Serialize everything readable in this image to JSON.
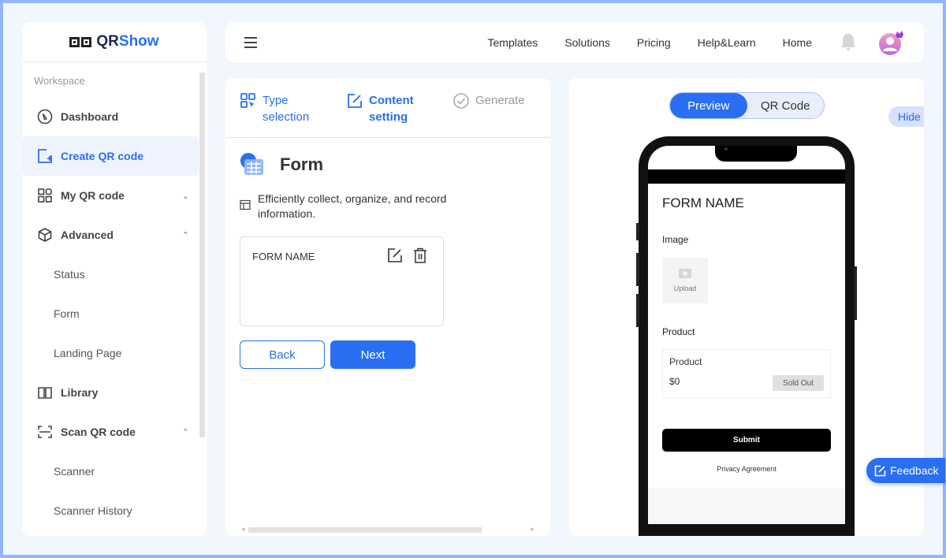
{
  "brand": {
    "name_prefix": "QR",
    "name_suffix": "Show"
  },
  "sidebar": {
    "section_label": "Workspace",
    "items": [
      {
        "label": "Dashboard",
        "icon": "dashboard-icon"
      },
      {
        "label": "Create QR code",
        "icon": "create-qr-icon",
        "active": true
      },
      {
        "label": "My QR code",
        "icon": "qr-grid-icon",
        "chevron": "down"
      },
      {
        "label": "Advanced",
        "icon": "cube-icon",
        "chevron": "up"
      },
      {
        "label": "Library",
        "icon": "book-icon"
      },
      {
        "label": "Scan QR code",
        "icon": "scan-icon",
        "chevron": "up"
      }
    ],
    "advanced_subitems": [
      "Status",
      "Form",
      "Landing Page"
    ],
    "scan_subitems": [
      "Scanner",
      "Scanner History"
    ]
  },
  "topbar": {
    "nav": [
      "Templates",
      "Solutions",
      "Pricing",
      "Help&Learn",
      "Home"
    ]
  },
  "steps": {
    "type_line1": "Type",
    "type_line2": "selection",
    "content_line1": "Content",
    "content_line2": "setting",
    "generate": "Generate"
  },
  "editor": {
    "title": "Form",
    "description": "Efficiently collect, organize, and record information.",
    "form_name": "FORM NAME",
    "back_label": "Back",
    "next_label": "Next"
  },
  "preview": {
    "tabs": [
      "Preview",
      "QR Code"
    ],
    "active_tab": "Preview",
    "hide_label": "Hide",
    "phone": {
      "form_title": "FORM NAME",
      "image_label": "Image",
      "upload_label": "Upload",
      "product_label": "Product",
      "product_name": "Product",
      "product_price": "$0",
      "sold_out": "Sold Out",
      "submit": "Submit",
      "privacy": "Privacy Agreement"
    }
  },
  "feedback_label": "Feedback",
  "colors": {
    "accent": "#2a6ef2",
    "frame": "#92b6fb",
    "background": "#f2f7fe"
  }
}
